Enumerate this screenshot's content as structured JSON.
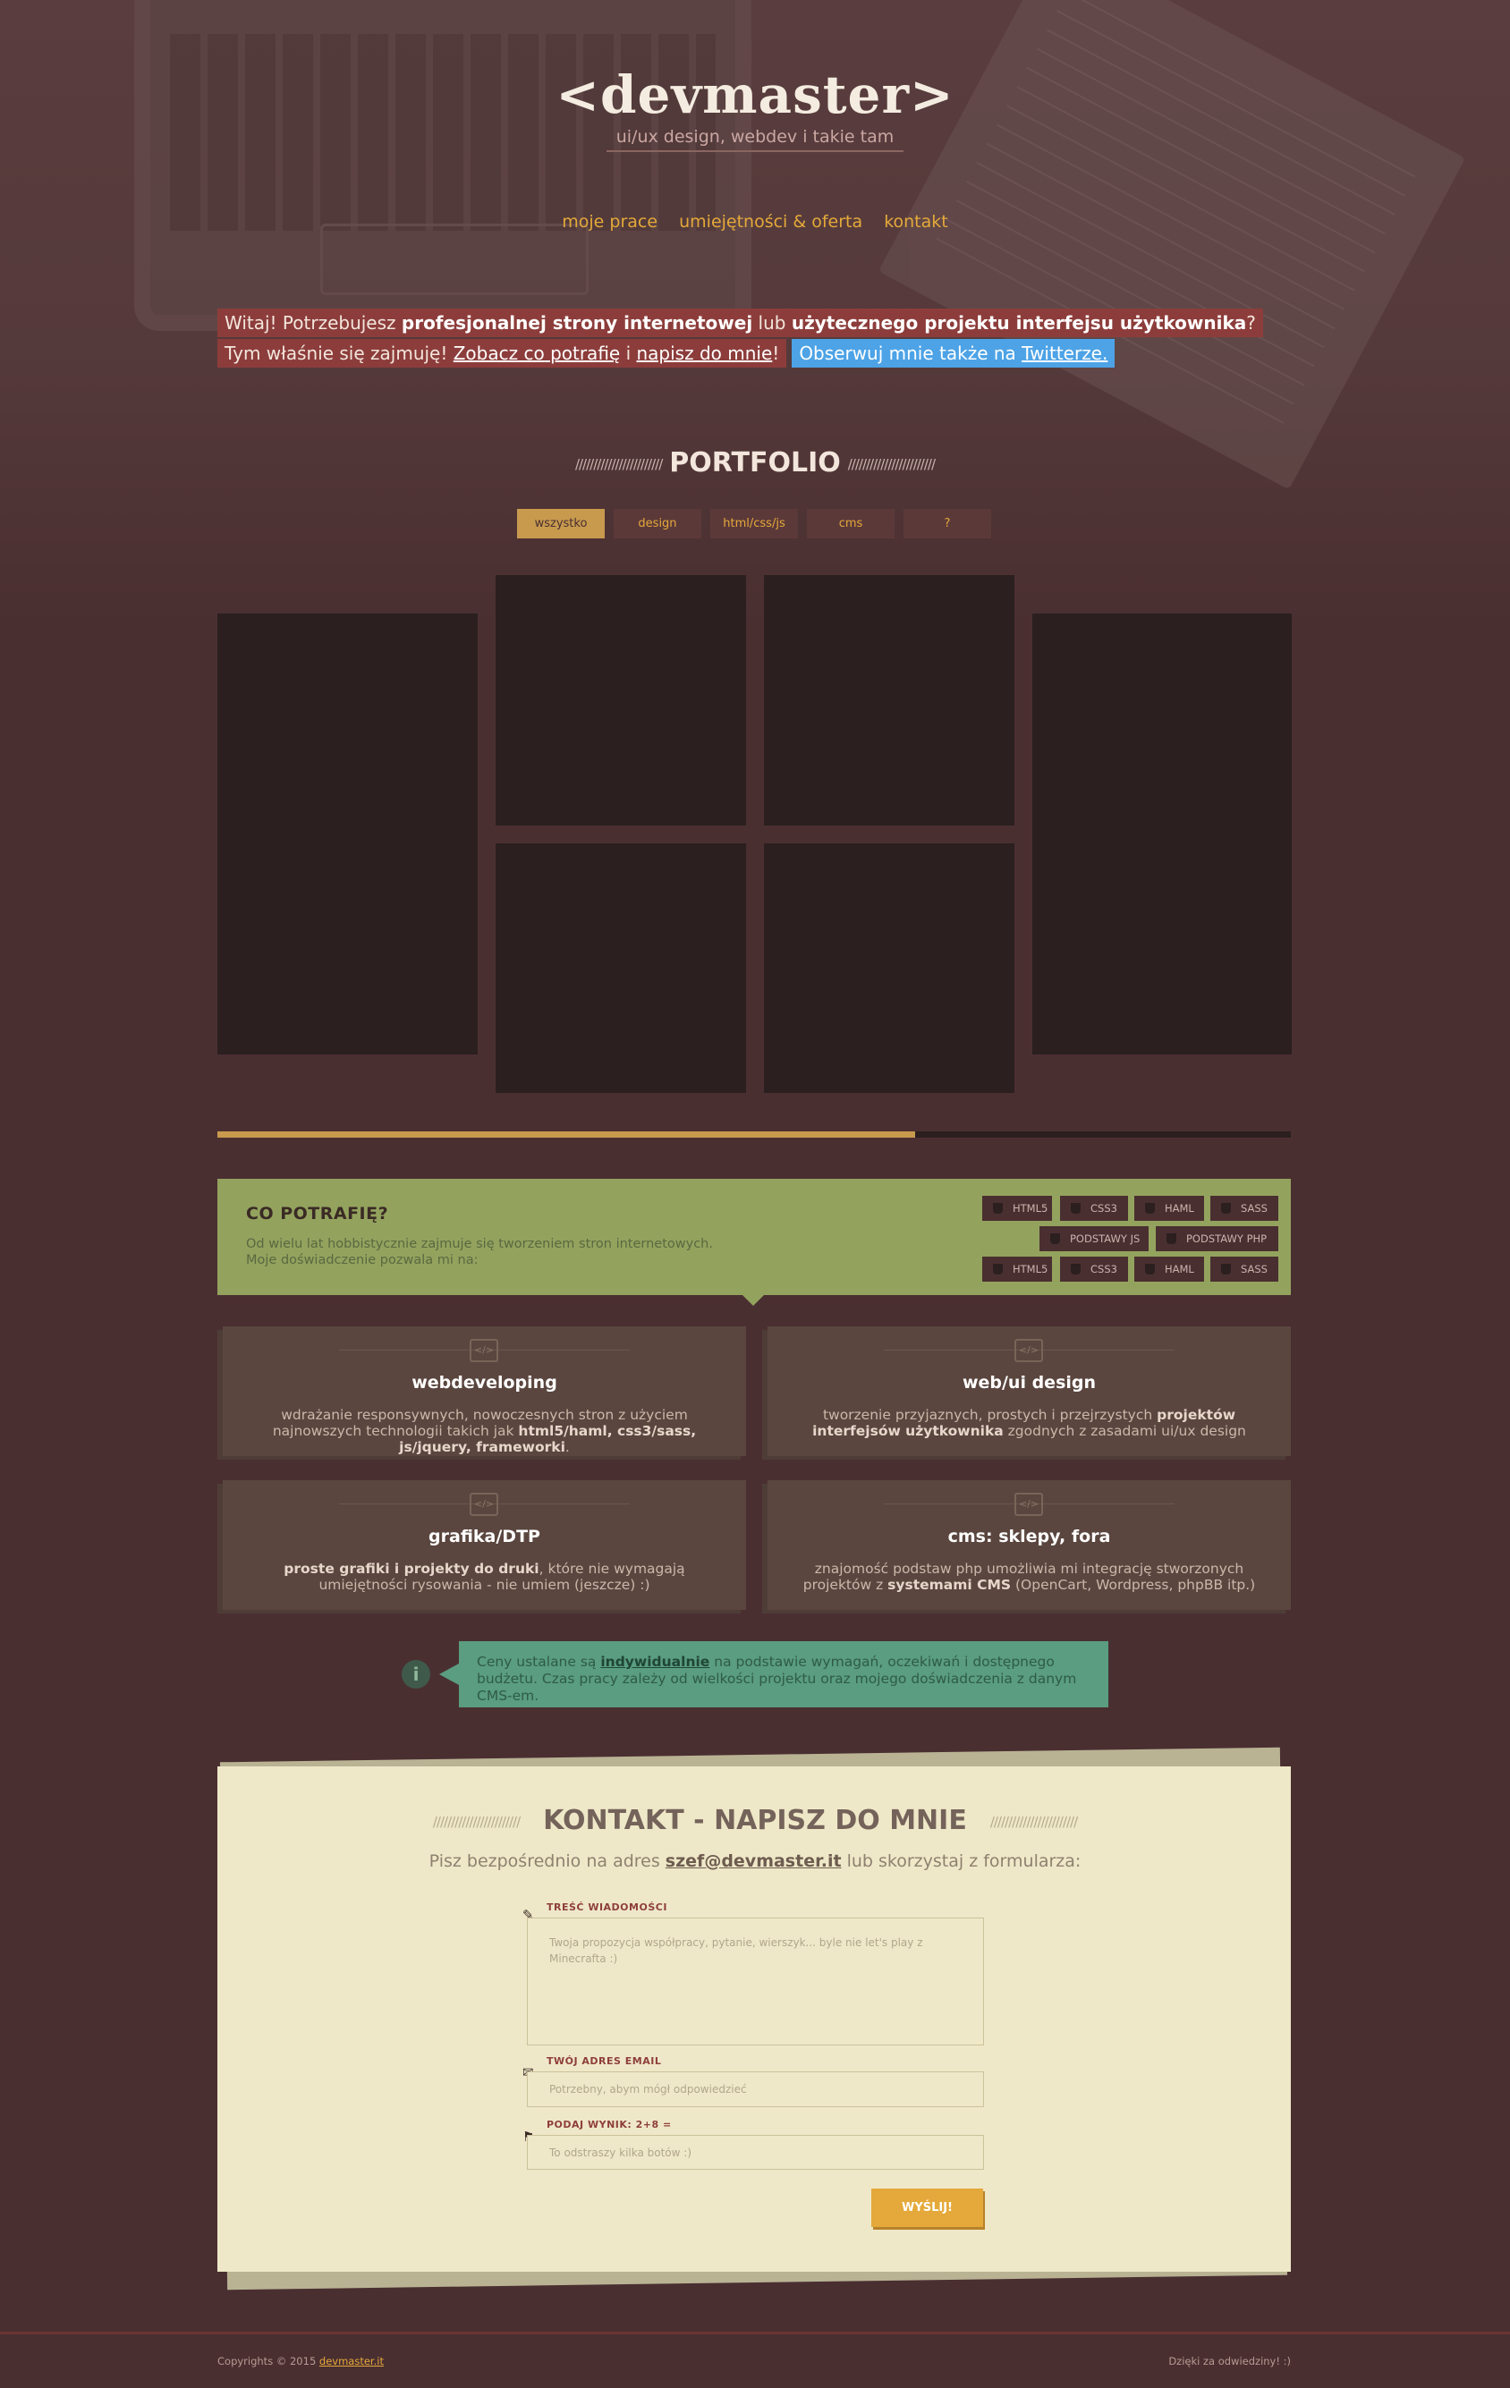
{
  "header": {
    "logo": "<devmaster>",
    "tagline": "ui/ux design, webdev i takie tam",
    "nav": [
      "moje prace",
      "umiejętności & oferta",
      "kontakt"
    ]
  },
  "intro": {
    "t1": "Witaj! Potrzebujesz ",
    "b1": "profesjonalnej strony internetowej",
    "t2": " lub ",
    "b2": "użytecznego projektu interfejsu użytkownika",
    "t3": "? Tym właśnie się zajmuję! ",
    "l1": "Zobacz co potrafię",
    "t4": " i ",
    "l2": "napisz do mnie",
    "t5": "!",
    "twitter_text": "Obserwuj mnie także na ",
    "twitter_link": "Twitterze."
  },
  "portfolio": {
    "slashes": "////////////////////////",
    "title": "PORTFOLIO",
    "filters": [
      "wszystko",
      "design",
      "html/css/js",
      "cms",
      "?"
    ],
    "active_filter": "wszystko",
    "progress": 0.65
  },
  "skills": {
    "title": "CO POTRAFIĘ?",
    "desc": "Od wielu lat hobbistycznie zajmuje się tworzeniem stron internetowych. Moje doświadczenie pozwala mi na:",
    "badges": [
      "HTML5",
      "CSS3",
      "HAML",
      "SASS",
      "PODSTAWY JS",
      "PODSTAWY PHP",
      "HTML5",
      "CSS3",
      "HAML",
      "SASS"
    ],
    "cards": [
      {
        "title": "webdeveloping",
        "pre": "wdrażanie responsywnych, nowoczesnych stron z użyciem najnowszych technologii takich jak ",
        "bold": "html5/haml, css3/sass, js/jquery, frameworki",
        "post": "."
      },
      {
        "title": "web/ui design",
        "pre": "tworzenie przyjaznych, prostych i przejrzystych ",
        "bold": "projektów interfejsów użytkownika",
        "post": " zgodnych z zasadami ui/ux design"
      },
      {
        "title": "grafika/DTP",
        "pre": "",
        "bold": "proste grafiki i projekty do druki",
        "post": ", które nie wymagają umiejętności rysowania - nie umiem (jeszcze) :)"
      },
      {
        "title": "cms: sklepy, fora",
        "pre": "znajomość podstaw php umożliwia mi integrację stworzonych projektów z ",
        "bold": "systemami CMS",
        "post": " (OpenCart, Wordpress, phpBB itp.)"
      }
    ],
    "icon_label": "</>"
  },
  "info": {
    "icon": "i",
    "t1": "Ceny ustalane są ",
    "b1": "indywidualnie",
    "t2": " na podstawie wymagań, oczekiwań i dostępnego budżetu. Czas pracy zależy od wielkości projektu oraz mojego doświadczenia z danym CMS-em."
  },
  "contact": {
    "title": "KONTAKT - NAPISZ DO MNIE",
    "sub_pre": "Pisz bezpośrednio na adres ",
    "email": "szef@devmaster.it",
    "sub_post": " lub skorzystaj z formularza:",
    "message_label": "TREŚĆ WIADOMOŚCI",
    "message_placeholder": "Twoja propozycja współpracy, pytanie, wierszyk... byle nie let's play z Minecrafta :)",
    "email_label": "TWÓJ ADRES EMAIL",
    "email_placeholder": "Potrzebny, abym mógł odpowiedzieć",
    "captcha_label": "PODAJ WYNIK: 2+8 =",
    "captcha_placeholder": "To odstraszy kilka botów :)",
    "send": "WYŚLIJ!"
  },
  "footer": {
    "copyright": "Copyrights © 2015 ",
    "site": "devmaster.it",
    "thanks": "Dzięki za odwiedziny! :)"
  },
  "colors": {
    "background": "#4a2f31",
    "accent": "#e4a93a",
    "skills_green": "#93a35e",
    "info_teal": "#5a9d80",
    "twitter_blue": "#4da3e6"
  }
}
